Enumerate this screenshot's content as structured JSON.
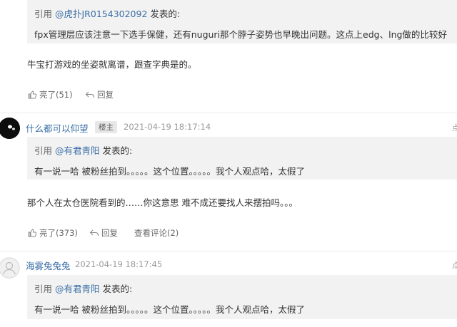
{
  "post1": {
    "quote_prefix": "引用",
    "quote_author": "@虎扑JR0154302092",
    "quote_suffix": "发表的:",
    "quote_text": "fpx管理层应该注意一下选手保健，还有nuguri那个脖子姿势也早晚出问题。这点上edg、lng做的比较好",
    "body": "牛宝打游戏的坐姿就离谱，跟查字典是的。",
    "like_label": "亮了(51)",
    "reply_label": "回复"
  },
  "post2": {
    "username": "什么都可以仰望",
    "badge": "楼主",
    "time": "2021-04-19 18:17:14",
    "report": "点",
    "quote_prefix": "引用",
    "quote_author": "@有君青阳",
    "quote_suffix": "发表的:",
    "quote_text": "有一说一哈 被粉丝拍到。。。。。这个位置。。。。。我个人观点哈，太假了",
    "body": "那个人在太仓医院看到的……你这意思 难不成还要找人来摆拍吗。。。",
    "like_label": "亮了(373)",
    "reply_label": "回复",
    "comments_label": "查看评论(2)"
  },
  "post3": {
    "username": "海雾兔兔兔",
    "time": "2021-04-19 18:17:45",
    "report": "点",
    "quote_prefix": "引用",
    "quote_author": "@有君青阳",
    "quote_suffix": "发表的:",
    "quote_text": "有一说一哈 被粉丝拍到。。。。。这个位置。。。。。我个人观点哈，太假了"
  },
  "icons": {
    "like": "thumbs-up-icon",
    "reply": "reply-arrow-icon",
    "avatar_default": "user-avatar-icon"
  },
  "colors": {
    "link": "#3a6ea5",
    "quote_bg": "#f2f2f2",
    "muted": "#666666",
    "timestamp": "#999999"
  }
}
